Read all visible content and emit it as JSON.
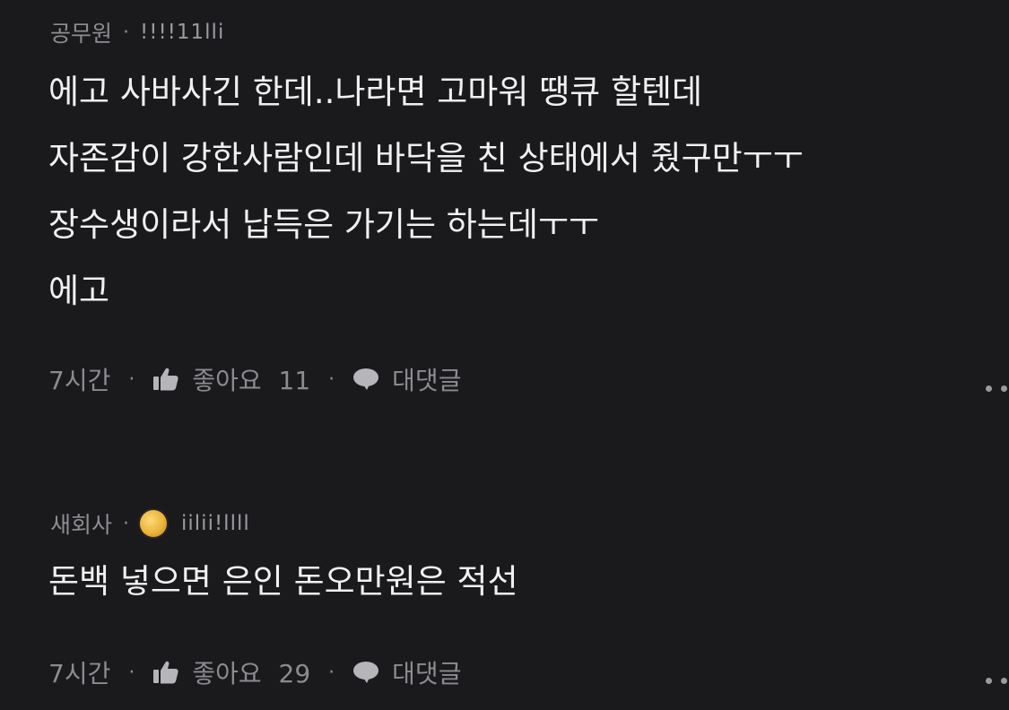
{
  "comments": [
    {
      "author": "공무원",
      "badge": "!!!!11lli",
      "lines": [
        "에고 사바사긴 한데..나라면 고마워 땡큐 할텐데",
        "자존감이 강한사람인데 바닥을 친 상태에서 줬구만ㅜㅜ",
        "장수생이라서 납득은 가기는 하는데ㅜㅜ",
        "에고"
      ],
      "time": "7시간",
      "like_label": "좋아요",
      "like_count": "11",
      "reply_label": "대댓글"
    },
    {
      "author": "새회사",
      "badge": "iilii!llll",
      "lines": [
        "돈백 넣으면 은인 돈오만원은 적선"
      ],
      "time": "7시간",
      "like_label": "좋아요",
      "like_count": "29",
      "reply_label": "대댓글"
    }
  ],
  "separator": "·",
  "icons": {
    "like": "thumbs-up-icon",
    "reply": "speech-bubble-icon",
    "more": "more-dots-icon",
    "medal": "medal-icon"
  },
  "colors": {
    "background": "#1a1a1d",
    "text": "#f0f0f0",
    "muted": "#8b8b90",
    "medal": "#e9b43a"
  }
}
